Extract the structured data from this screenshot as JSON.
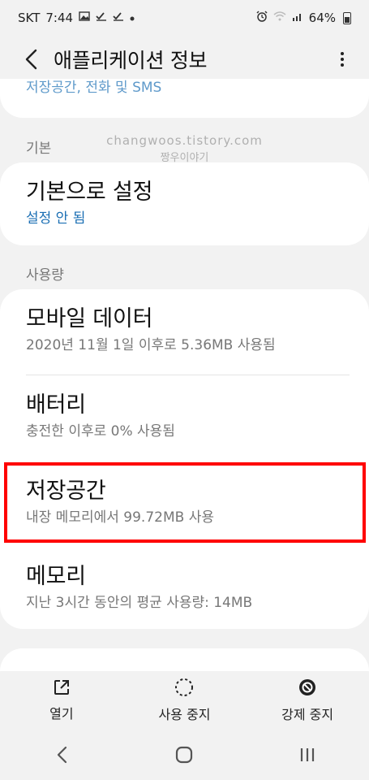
{
  "status_bar": {
    "carrier": "SKT",
    "time": "7:44",
    "battery": "64%"
  },
  "appbar": {
    "title": "애플리케이션 정보"
  },
  "partial_item": {
    "text": "저장공간, 전화 및 SMS"
  },
  "watermark": {
    "line1": "changwoos.tistory.com",
    "line2": "짱우이야기"
  },
  "sections": {
    "basic": {
      "label": "기본",
      "item": {
        "title": "기본으로 설정",
        "subtitle": "설정 안 됨"
      }
    },
    "usage": {
      "label": "사용량",
      "items": [
        {
          "title": "모바일 데이터",
          "subtitle": "2020년 11월 1일 이후로 5.36MB 사용됨"
        },
        {
          "title": "배터리",
          "subtitle": "충전한 이후로 0% 사용됨"
        },
        {
          "title": "저장공간",
          "subtitle": "내장 메모리에서 99.72MB 사용"
        },
        {
          "title": "메모리",
          "subtitle": "지난 3시간 동안의 평균 사용량: 14MB"
        }
      ]
    }
  },
  "actions": {
    "open": "열기",
    "disable": "사용 중지",
    "force_stop": "강제 중지"
  },
  "colors": {
    "accent": "#1b6fb4",
    "highlight": "#ff0000",
    "background": "#f2f2f2"
  }
}
